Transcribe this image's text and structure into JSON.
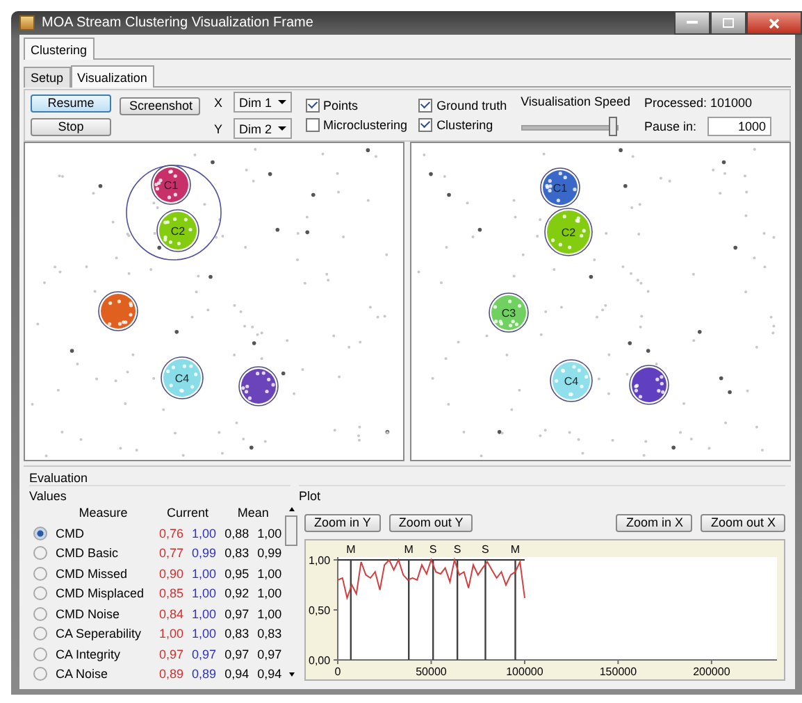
{
  "window": {
    "title": "MOA Stream Clustering Visualization Frame"
  },
  "main_tabs": [
    {
      "label": "Clustering",
      "selected": true
    }
  ],
  "sub_tabs": [
    {
      "label": "Setup",
      "selected": false
    },
    {
      "label": "Visualization",
      "selected": true
    }
  ],
  "controls": {
    "buttons": [
      {
        "label": "Resume",
        "focused": true
      },
      {
        "label": "Stop",
        "focused": false
      }
    ],
    "screenshot_button": "Screenshot",
    "axes": [
      {
        "axis": "X",
        "value": "Dim 1"
      },
      {
        "axis": "Y",
        "value": "Dim 2"
      }
    ],
    "checkboxes": [
      {
        "label": "Points",
        "checked": true
      },
      {
        "label": "Microclustering",
        "checked": false
      },
      {
        "label": "Ground truth",
        "checked": true
      },
      {
        "label": "Clustering",
        "checked": true
      }
    ],
    "speed": {
      "label": "Visualisation Speed",
      "level": 1
    },
    "processed": "Processed: 101000",
    "pause": {
      "label": "Pause in:",
      "value": "1000"
    }
  },
  "views": [
    {
      "clusters": [
        {
          "label": "C1",
          "color": "#c8306a"
        },
        {
          "label": "C2",
          "color": "#84cc10"
        },
        {
          "color": "#e06020"
        },
        {
          "label": "C4",
          "color": "#88dde8"
        },
        {
          "color": "#6a44b8"
        }
      ]
    },
    {
      "clusters": [
        {
          "label": "C1",
          "color": "#3a68c8"
        },
        {
          "label": "C2",
          "color": "#84cc10"
        },
        {
          "label": "C3",
          "color": "#70d060"
        },
        {
          "label": "C4",
          "color": "#90e0ec"
        },
        {
          "color": "#6040c0"
        }
      ]
    }
  ],
  "evaluation": {
    "title": "Evaluation",
    "values": {
      "title": "Values",
      "columns": [
        "Measure",
        "Current",
        "Mean"
      ],
      "rows": [
        {
          "measure": "CMD",
          "selected": true,
          "current": [
            "0,76",
            "1,00"
          ],
          "mean": [
            "0,88",
            "1,00"
          ]
        },
        {
          "measure": "CMD Basic",
          "selected": false,
          "current": [
            "0,77",
            "0,99"
          ],
          "mean": [
            "0,83",
            "0,99"
          ]
        },
        {
          "measure": "CMD Missed",
          "selected": false,
          "current": [
            "0,90",
            "1,00"
          ],
          "mean": [
            "0,95",
            "1,00"
          ]
        },
        {
          "measure": "CMD Misplaced",
          "selected": false,
          "current": [
            "0,85",
            "1,00"
          ],
          "mean": [
            "0,92",
            "1,00"
          ]
        },
        {
          "measure": "CMD Noise",
          "selected": false,
          "current": [
            "0,84",
            "1,00"
          ],
          "mean": [
            "0,97",
            "1,00"
          ]
        },
        {
          "measure": "CA Seperability",
          "selected": false,
          "current": [
            "1,00",
            "1,00"
          ],
          "mean": [
            "0,83",
            "0,83"
          ]
        },
        {
          "measure": "CA Integrity",
          "selected": false,
          "current": [
            "0,97",
            "0,97"
          ],
          "mean": [
            "0,97",
            "0,97"
          ]
        },
        {
          "measure": "CA Noise",
          "selected": false,
          "current": [
            "0,89",
            "0,89"
          ],
          "mean": [
            "0,94",
            "0,94"
          ]
        }
      ]
    },
    "plot": {
      "title": "Plot",
      "buttons": [
        "Zoom in Y",
        "Zoom out Y",
        "Zoom in X",
        "Zoom out X"
      ],
      "chart_data": {
        "type": "line",
        "x": [
          0,
          2500,
          5000,
          7500,
          10000,
          12500,
          15000,
          17500,
          20000,
          22500,
          25000,
          27500,
          30000,
          32500,
          35000,
          37500,
          40000,
          42500,
          45000,
          47500,
          50000,
          52500,
          55000,
          57500,
          60000,
          62500,
          65000,
          67500,
          70000,
          72500,
          75000,
          77500,
          80000,
          82500,
          85000,
          87500,
          90000,
          92500,
          95000,
          97500,
          100000
        ],
        "series": [
          {
            "color": "#d04040",
            "values": [
              0.8,
              0.82,
              0.62,
              0.75,
              0.66,
              0.98,
              0.85,
              0.82,
              0.88,
              0.7,
              0.95,
              1.0,
              0.9,
              1.0,
              0.85,
              0.8,
              0.82,
              0.8,
              0.95,
              0.86,
              1.0,
              0.88,
              0.86,
              0.92,
              0.78,
              1.0,
              0.85,
              0.88,
              0.72,
              0.95,
              0.85,
              0.92,
              0.98,
              0.9,
              0.82,
              0.88,
              0.75,
              0.85,
              0.88,
              0.98,
              0.62
            ]
          }
        ],
        "xlim": [
          0,
          235000
        ],
        "ylim": [
          0,
          1
        ],
        "xticks": [
          0,
          50000,
          100000,
          150000,
          200000
        ],
        "yticks": [
          {
            "value": 0,
            "label": "0,00"
          },
          {
            "value": 0.5,
            "label": "0,50"
          },
          {
            "value": 1,
            "label": "1,00"
          }
        ],
        "ref_lines": [
          {
            "axis": "x",
            "value": 7000,
            "label": "M"
          },
          {
            "axis": "x",
            "value": 38000,
            "label": "M"
          },
          {
            "axis": "x",
            "value": 51000,
            "label": "S"
          },
          {
            "axis": "x",
            "value": 64000,
            "label": "S"
          },
          {
            "axis": "x",
            "value": 79000,
            "label": "S"
          },
          {
            "axis": "x",
            "value": 95000,
            "label": "M"
          }
        ]
      }
    }
  }
}
